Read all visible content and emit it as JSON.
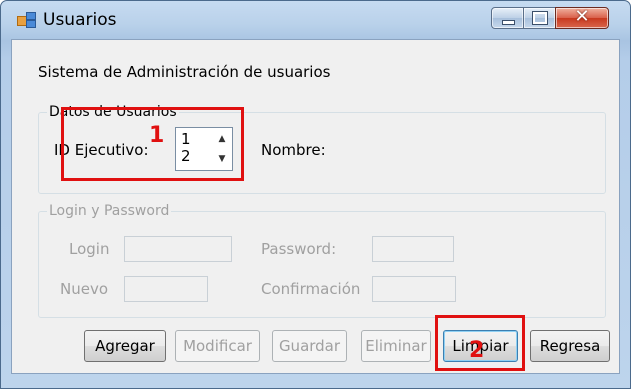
{
  "window": {
    "title": "Usuarios",
    "controls": [
      "minimize-icon",
      "maximize-icon",
      "close-icon"
    ]
  },
  "main": {
    "heading": "Sistema de Administración de usuarios",
    "datos_group": {
      "legend": "Datos de Usuarios",
      "id_label": "ID Ejecutivo:",
      "id_spinner_values": [
        "1",
        "2"
      ],
      "nombre_label": "Nombre:"
    },
    "login_group": {
      "legend": "Login y Password",
      "login_label": "Login",
      "password_label": "Password:",
      "nuevo_label": "Nuevo",
      "confirmacion_label": "Confirmación"
    },
    "buttons": {
      "agregar": "Agregar",
      "modificar": "Modificar",
      "guardar": "Guardar",
      "eliminar": "Eliminar",
      "limpiar": "Limpiar",
      "regresa": "Regresa"
    }
  },
  "annotations": {
    "marker_1": "1",
    "marker_2": "2",
    "color": "#e01010"
  }
}
